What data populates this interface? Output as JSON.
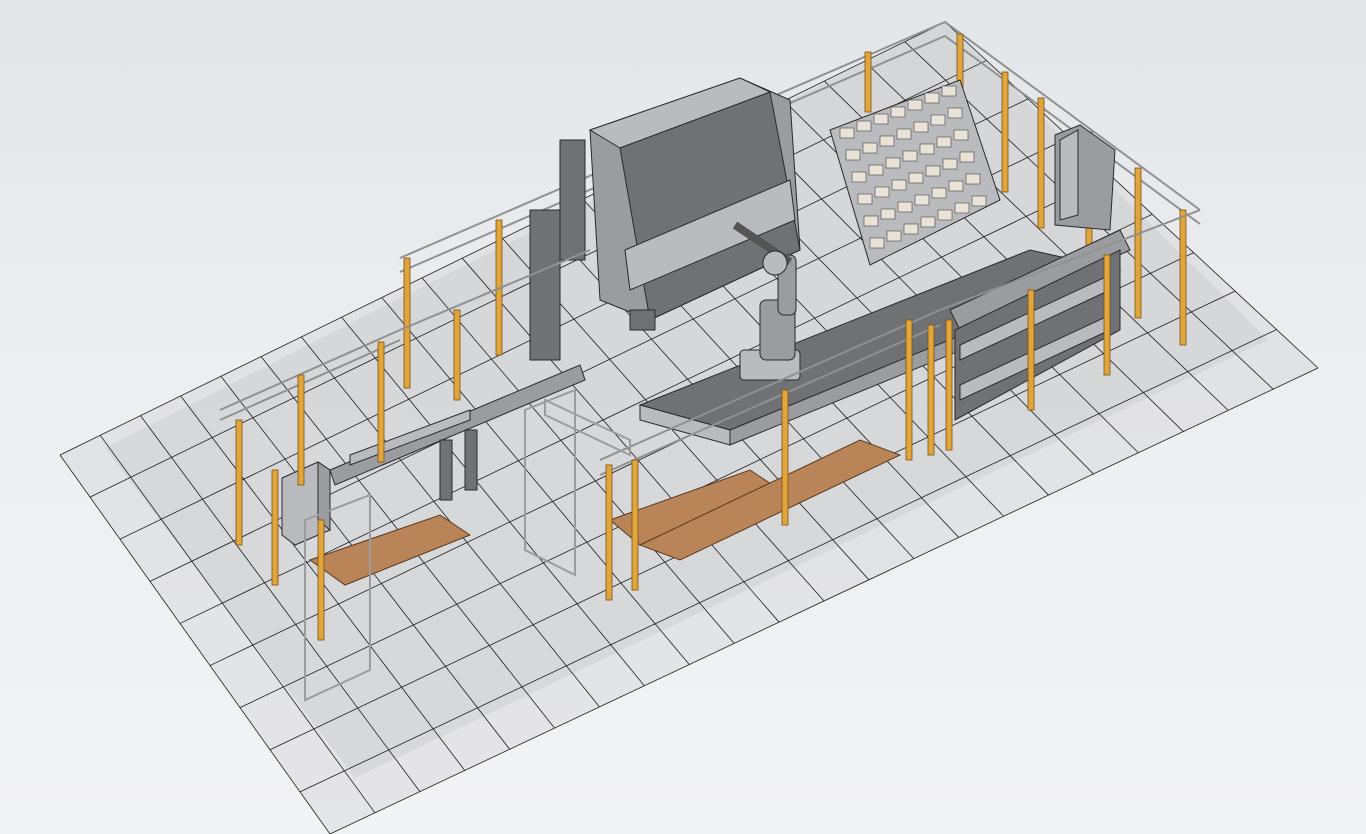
{
  "viewport": {
    "background_top": "#e3e5e8",
    "background_bottom": "#f2f3f5"
  },
  "scene": {
    "floor_fill": "#d8d9da",
    "grid_color": "#1e1e1e",
    "fence_post_color": "#e0a53c",
    "fence_rail_color": "#8f9193",
    "machine_color": "#9a9c9f",
    "pallet_color": "#b98558",
    "sign_color": "#2456b5",
    "objects": [
      {
        "name": "press-brake"
      },
      {
        "name": "robot-arm"
      },
      {
        "name": "conveyor-belt"
      },
      {
        "name": "part-storage-rack"
      },
      {
        "name": "electrical-cabinet"
      },
      {
        "name": "safety-fence"
      },
      {
        "name": "gantry-loader"
      },
      {
        "name": "wood-pallets"
      },
      {
        "name": "tool-storage-rack"
      },
      {
        "name": "control-cabinet"
      }
    ]
  }
}
